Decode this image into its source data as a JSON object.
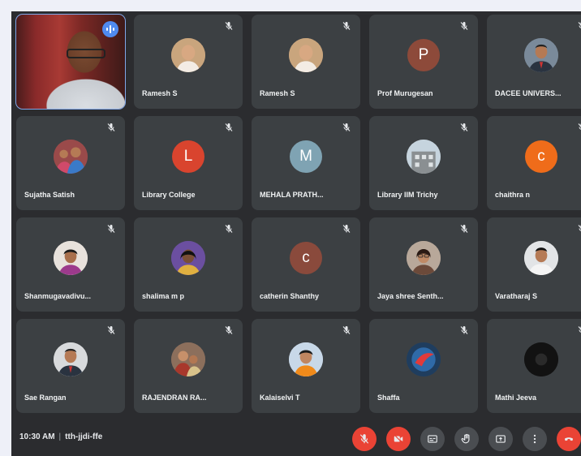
{
  "participants": [
    {
      "name": "",
      "kind": "video",
      "speaking": true
    },
    {
      "name": "Ramesh S",
      "kind": "photo",
      "photo": "bald-man",
      "bg": "#c9a57d"
    },
    {
      "name": "Ramesh S",
      "kind": "photo",
      "photo": "bald-man",
      "bg": "#c9a57d"
    },
    {
      "name": "Prof Murugesan",
      "kind": "initial",
      "initial": "P",
      "bg": "#8d4a3a"
    },
    {
      "name": "DACEE UNIVERS...",
      "kind": "photo",
      "photo": "man-suit",
      "bg": "#7a8a9a"
    },
    {
      "name": "Sujatha Satish",
      "kind": "photo",
      "photo": "group",
      "bg": "#9a4a4a"
    },
    {
      "name": "Library College",
      "kind": "initial",
      "initial": "L",
      "bg": "#d9442e"
    },
    {
      "name": "MEHALA PRATH...",
      "kind": "initial",
      "initial": "M",
      "bg": "#7fa3b3"
    },
    {
      "name": "Library IIM Trichy",
      "kind": "photo",
      "photo": "building",
      "bg": "#9fa6a8"
    },
    {
      "name": "chaithra n",
      "kind": "initial",
      "initial": "c",
      "bg": "#ef6c1a"
    },
    {
      "name": "Shanmugavadivu...",
      "kind": "photo",
      "photo": "woman",
      "bg": "#e8e2dc"
    },
    {
      "name": "shalima m p",
      "kind": "photo",
      "photo": "woman-dark",
      "bg": "#6b4fa0"
    },
    {
      "name": "catherin Shanthy",
      "kind": "initial",
      "initial": "c",
      "bg": "#8a4a3c"
    },
    {
      "name": "Jaya shree Senth...",
      "kind": "photo",
      "photo": "woman-glasses",
      "bg": "#b8a89a"
    },
    {
      "name": "Varatharaj S",
      "kind": "photo",
      "photo": "man",
      "bg": "#e2e4e6"
    },
    {
      "name": "Sae Rangan",
      "kind": "photo",
      "photo": "man-suit",
      "bg": "#d8dadc"
    },
    {
      "name": "RAJENDRAN RA...",
      "kind": "photo",
      "photo": "family",
      "bg": "#8c6f5c"
    },
    {
      "name": "Kalaiselvi T",
      "kind": "photo",
      "photo": "woman-saree",
      "bg": "#c8d8e8"
    },
    {
      "name": "Shaffa",
      "kind": "photo",
      "photo": "abstract",
      "bg": "#2a4a6a"
    },
    {
      "name": "Mathi Jeeva",
      "kind": "photo",
      "photo": "dark",
      "bg": "#1a1a1a"
    }
  ],
  "meeting": {
    "time": "10:30 AM",
    "separator": "|",
    "code": "tth-jjdi-ffe"
  },
  "controls": [
    {
      "icon": "mic-off-icon",
      "bg": "#ea4335"
    },
    {
      "icon": "camera-off-icon",
      "bg": "#ea4335"
    },
    {
      "icon": "captions-icon",
      "bg": "#4a4d51"
    },
    {
      "icon": "raise-hand-icon",
      "bg": "#4a4d51"
    },
    {
      "icon": "present-icon",
      "bg": "#4a4d51"
    },
    {
      "icon": "more-options-icon",
      "bg": "#4a4d51"
    },
    {
      "icon": "end-call-icon",
      "bg": "#ea4335"
    }
  ]
}
